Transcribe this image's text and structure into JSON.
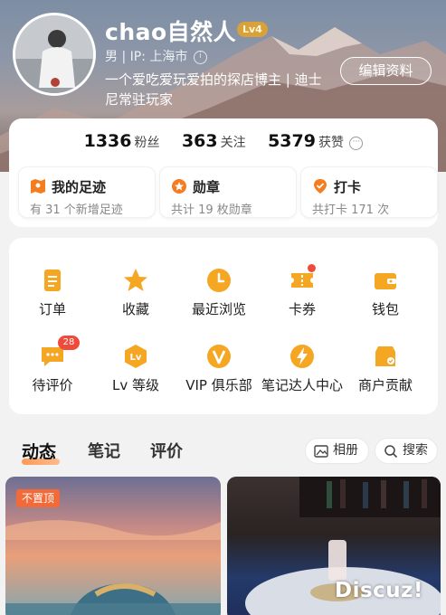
{
  "profile": {
    "username": "chao自然人",
    "level_badge": "Lv4",
    "gender": "男",
    "ip_location": "IP: 上海市",
    "bio": "一个爱吃爱玩爱拍的探店博主 | 迪士尼常驻玩家",
    "edit_label": "编辑资料"
  },
  "stats": [
    {
      "value": "1336",
      "label": "粉丝"
    },
    {
      "value": "363",
      "label": "关注"
    },
    {
      "value": "5379",
      "label": "获赞"
    }
  ],
  "highlights": [
    {
      "title": "我的足迹",
      "subtitle": "有 31 个新增足迹",
      "icon": "map-pin-icon"
    },
    {
      "title": "勋章",
      "subtitle": "共计 19 枚勋章",
      "icon": "medal-icon"
    },
    {
      "title": "打卡",
      "subtitle": "共打卡 171 次",
      "icon": "checkin-icon"
    }
  ],
  "services": [
    {
      "label": "订单",
      "icon": "order-icon"
    },
    {
      "label": "收藏",
      "icon": "star-icon"
    },
    {
      "label": "最近浏览",
      "icon": "clock-icon"
    },
    {
      "label": "卡券",
      "icon": "ticket-icon",
      "dot": true
    },
    {
      "label": "钱包",
      "icon": "wallet-icon"
    },
    {
      "label": "待评价",
      "icon": "comment-icon",
      "badge": "28"
    },
    {
      "label": "Lv 等级",
      "icon": "level-icon"
    },
    {
      "label": "VIP 俱乐部",
      "icon": "vip-icon"
    },
    {
      "label": "笔记达人中心",
      "icon": "lightning-icon"
    },
    {
      "label": "商户贡献",
      "icon": "shop-icon"
    }
  ],
  "tabs": [
    {
      "label": "动态",
      "active": true
    },
    {
      "label": "笔记",
      "active": false
    },
    {
      "label": "评价",
      "active": false
    }
  ],
  "actions": {
    "album": "相册",
    "search": "搜索"
  },
  "feed": {
    "pin_label": "不置顶"
  },
  "watermark": "Discuz!",
  "colors": {
    "accent": "#f57c1f",
    "badge_red": "#f04b3a",
    "level_gold": "#d8a13a"
  }
}
